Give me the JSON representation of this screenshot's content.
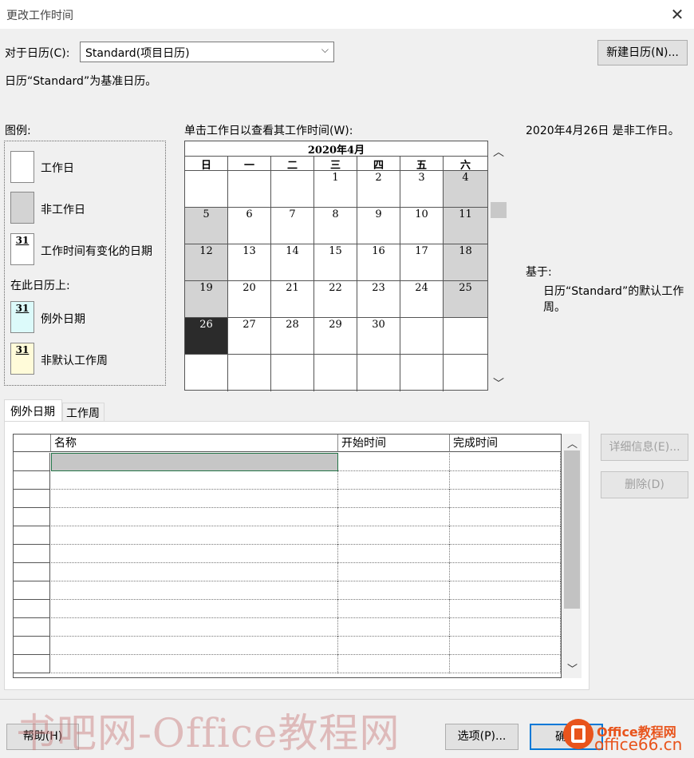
{
  "window": {
    "title": "更改工作时间",
    "close_glyph": "✕"
  },
  "calendar_select": {
    "label": "对于日历(C):",
    "value": "Standard(项目日历)",
    "arrow": "⌵"
  },
  "new_calendar_button": "新建日历(N)...",
  "base_info": "日历“Standard”为基准日历。",
  "legend": {
    "heading": "图例:",
    "items": [
      {
        "label": "工作日",
        "number": ""
      },
      {
        "label": "非工作日",
        "number": ""
      },
      {
        "label": "工作时间有变化的日期",
        "number": "31"
      }
    ],
    "on_calendar_heading": "在此日历上:",
    "on_calendar_items": [
      {
        "label": "例外日期",
        "number": "31"
      },
      {
        "label": "非默认工作周",
        "number": "31"
      }
    ],
    "colors": {
      "working": "#ffffff",
      "nonworking": "#d3d3d3",
      "exception": "#dcfafa",
      "nondefault": "#fffbd9"
    }
  },
  "calendar": {
    "instruction": "单击工作日以查看其工作时间(W):",
    "month_title": "2020年4月",
    "weekdays": [
      "日",
      "一",
      "二",
      "三",
      "四",
      "五",
      "六"
    ],
    "weeks": [
      [
        "",
        "",
        "",
        "1",
        "2",
        "3",
        "4"
      ],
      [
        "5",
        "6",
        "7",
        "8",
        "9",
        "10",
        "11"
      ],
      [
        "12",
        "13",
        "14",
        "15",
        "16",
        "17",
        "18"
      ],
      [
        "19",
        "20",
        "21",
        "22",
        "23",
        "24",
        "25"
      ],
      [
        "26",
        "27",
        "28",
        "29",
        "30",
        "",
        ""
      ],
      [
        "",
        "",
        "",
        "",
        "",
        "",
        ""
      ]
    ],
    "selected_day": "26",
    "scroll_up": "︿",
    "scroll_down": "﹀"
  },
  "day_info": {
    "status": "2020年4月26日 是非工作日。",
    "based_on_label": "基于:",
    "based_on_text": "日历“Standard”的默认工作周。"
  },
  "tabs": [
    "例外日期",
    "工作周"
  ],
  "exceptions_table": {
    "columns": [
      "名称",
      "开始时间",
      "完成时间"
    ],
    "row_count": 12,
    "scroll_up": "︿",
    "scroll_down": "﹀"
  },
  "side_buttons": {
    "details": "详细信息(E)...",
    "delete": "删除(D)"
  },
  "footer": {
    "help": "帮助(H)",
    "options": "选项(P)...",
    "ok": "确"
  },
  "watermark": {
    "text": "书吧网-Office教程网",
    "logo_text_1": "Office教程网",
    "logo_text_2": "office66.cn"
  }
}
